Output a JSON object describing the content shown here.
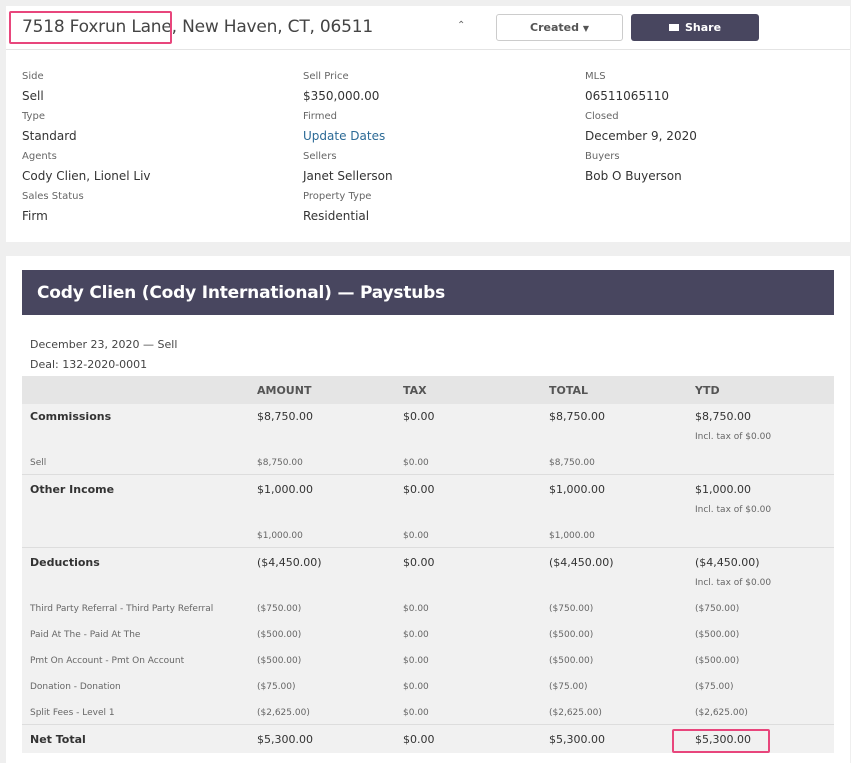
{
  "header": {
    "address_street": "7518 Foxrun Lane",
    "address_rest": ", New Haven, CT, 06511",
    "created_label": "Created",
    "share_label": "Share"
  },
  "details": {
    "side_label": "Side",
    "side_value": "Sell",
    "sell_price_label": "Sell Price",
    "sell_price_value": "$350,000.00",
    "mls_label": "MLS",
    "mls_value": "06511065110",
    "type_label": "Type",
    "type_value": "Standard",
    "firmed_label": "Firmed",
    "firmed_value": "Update Dates",
    "closed_label": "Closed",
    "closed_value": "December 9, 2020",
    "agents_label": "Agents",
    "agents_value": "Cody Clien, Lionel Liv",
    "sellers_label": "Sellers",
    "sellers_value": "Janet Sellerson",
    "buyers_label": "Buyers",
    "buyers_value": "Bob O Buyerson",
    "sales_status_label": "Sales Status",
    "sales_status_value": "Firm",
    "property_type_label": "Property Type",
    "property_type_value": "Residential"
  },
  "paystubs": {
    "title": "Cody Clien (Cody International) — Paystubs",
    "date_line": "December 23, 2020 — Sell",
    "deal_line": "Deal: 132-2020-0001",
    "columns": [
      "AMOUNT",
      "TAX",
      "TOTAL",
      "YTD"
    ],
    "commissions": {
      "label": "Commissions",
      "amount": "$8,750.00",
      "tax": "$0.00",
      "total": "$8,750.00",
      "ytd": "$8,750.00",
      "ytd_note": "Incl. tax of $0.00",
      "sub": [
        {
          "label": "Sell",
          "amount": "$8,750.00",
          "tax": "$0.00",
          "total": "$8,750.00",
          "ytd": ""
        }
      ]
    },
    "other_income": {
      "label": "Other Income",
      "amount": "$1,000.00",
      "tax": "$0.00",
      "total": "$1,000.00",
      "ytd": "$1,000.00",
      "ytd_note": "Incl. tax of $0.00",
      "sub": [
        {
          "label": "",
          "amount": "$1,000.00",
          "tax": "$0.00",
          "total": "$1,000.00",
          "ytd": ""
        }
      ]
    },
    "deductions": {
      "label": "Deductions",
      "amount": "($4,450.00)",
      "tax": "$0.00",
      "total": "($4,450.00)",
      "ytd": "($4,450.00)",
      "ytd_note": "Incl. tax of $0.00",
      "sub": [
        {
          "label": "Third Party Referral - Third Party Referral",
          "amount": "($750.00)",
          "tax": "$0.00",
          "total": "($750.00)",
          "ytd": "($750.00)"
        },
        {
          "label": "Paid At The - Paid At The",
          "amount": "($500.00)",
          "tax": "$0.00",
          "total": "($500.00)",
          "ytd": "($500.00)"
        },
        {
          "label": "Pmt On Account - Pmt On Account",
          "amount": "($500.00)",
          "tax": "$0.00",
          "total": "($500.00)",
          "ytd": "($500.00)"
        },
        {
          "label": "Donation - Donation",
          "amount": "($75.00)",
          "tax": "$0.00",
          "total": "($75.00)",
          "ytd": "($75.00)"
        },
        {
          "label": "Split Fees - Level 1",
          "amount": "($2,625.00)",
          "tax": "$0.00",
          "total": "($2,625.00)",
          "ytd": "($2,625.00)"
        }
      ]
    },
    "net_total": {
      "label": "Net Total",
      "amount": "$5,300.00",
      "tax": "$0.00",
      "total": "$5,300.00",
      "ytd": "$5,300.00"
    }
  }
}
